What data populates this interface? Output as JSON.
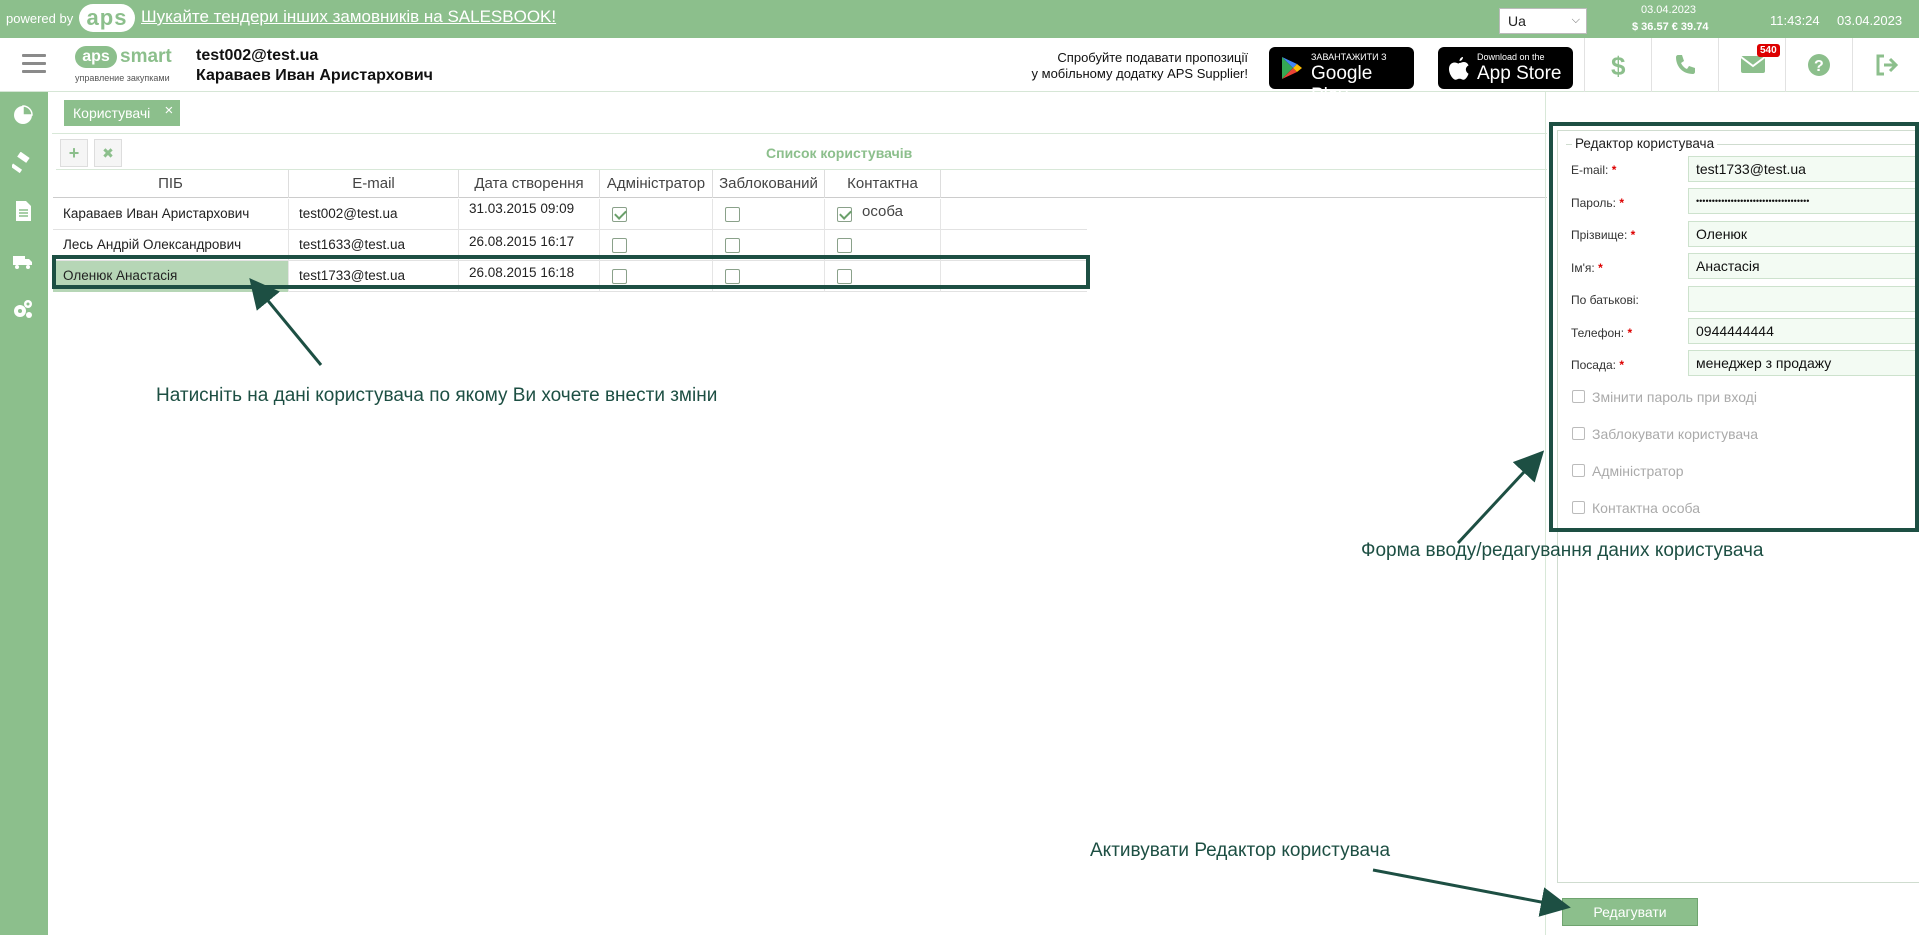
{
  "topbar": {
    "powered_by": "powered by",
    "logo_text": "aps",
    "link_text": "Шукайте тендери інших замовників на SALESBOOK!",
    "language": "Ua",
    "rates_date": "03.04.2023",
    "rates": "$ 36.57  € 39.74",
    "time": "11:43:24",
    "date": "03.04.2023"
  },
  "header": {
    "brand_aps": "aps",
    "brand_smart": "smart",
    "brand_sub": "управление закупками",
    "user_email": "test002@test.ua",
    "user_name": "Караваев Иван Аристархович",
    "promo_line1": "Спробуйте подавати пропозиції",
    "promo_line2": "у мобільному додатку APS Supplier!",
    "google_play_small": "ЗАВАНТАЖИТИ З",
    "google_play_big": "Google Play",
    "app_store_small": "Download on the",
    "app_store_big": "App Store",
    "mail_badge": "540"
  },
  "tabs": [
    {
      "label": "Користувачі",
      "close": "×"
    }
  ],
  "list": {
    "title": "Список користувачів",
    "add_icon": "+",
    "delete_icon": "✖",
    "columns": [
      "ПІБ",
      "E-mail",
      "Дата створення",
      "Адміністратор",
      "Заблокований",
      "Контактна особа"
    ],
    "rows": [
      {
        "name": "Караваев Иван Аристархович",
        "email": "test002@test.ua",
        "created": "31.03.2015 09:09",
        "admin": true,
        "blocked": false,
        "contact": true
      },
      {
        "name": "Лесь Андрій Олександрович",
        "email": "test1633@test.ua",
        "created": "26.08.2015 16:17",
        "admin": false,
        "blocked": false,
        "contact": false
      },
      {
        "name": "Оленюк Анастасія",
        "email": "test1733@test.ua",
        "created": "26.08.2015 16:18",
        "admin": false,
        "blocked": false,
        "contact": false
      }
    ],
    "selected_row": 2
  },
  "notes": {
    "click_user": "Натисніть на дані користувача по якому Ви хочете внести зміни",
    "form_hint": "Форма вводу/редагування даних користувача",
    "activate_hint": "Активувати Редактор користувача"
  },
  "editor": {
    "legend": "Редактор користувача",
    "fields": [
      {
        "label": "E-mail:",
        "required": true,
        "value": "test1733@test.ua"
      },
      {
        "label": "Пароль:",
        "required": true,
        "value": "••••••••••••••••••••••••••••••••••••"
      },
      {
        "label": "Прізвище:",
        "required": true,
        "value": "Оленюк"
      },
      {
        "label": "Ім'я:",
        "required": true,
        "value": "Анастасія"
      },
      {
        "label": "По батькові:",
        "required": false,
        "value": ""
      },
      {
        "label": "Телефон:",
        "required": true,
        "value": "0944444444"
      },
      {
        "label": "Посада:",
        "required": true,
        "value": "менеджер з продажу"
      }
    ],
    "checkboxes": [
      {
        "label": "Змінити пароль при вході",
        "checked": false
      },
      {
        "label": "Заблокувати користувача",
        "checked": false
      },
      {
        "label": "Адміністратор",
        "checked": false
      },
      {
        "label": "Контактна особа",
        "checked": false
      }
    ],
    "edit_button": "Редагувати"
  },
  "colors": {
    "brand_green": "#8cbf8c",
    "annotation": "#1d4f43",
    "required": "#dd0000"
  }
}
